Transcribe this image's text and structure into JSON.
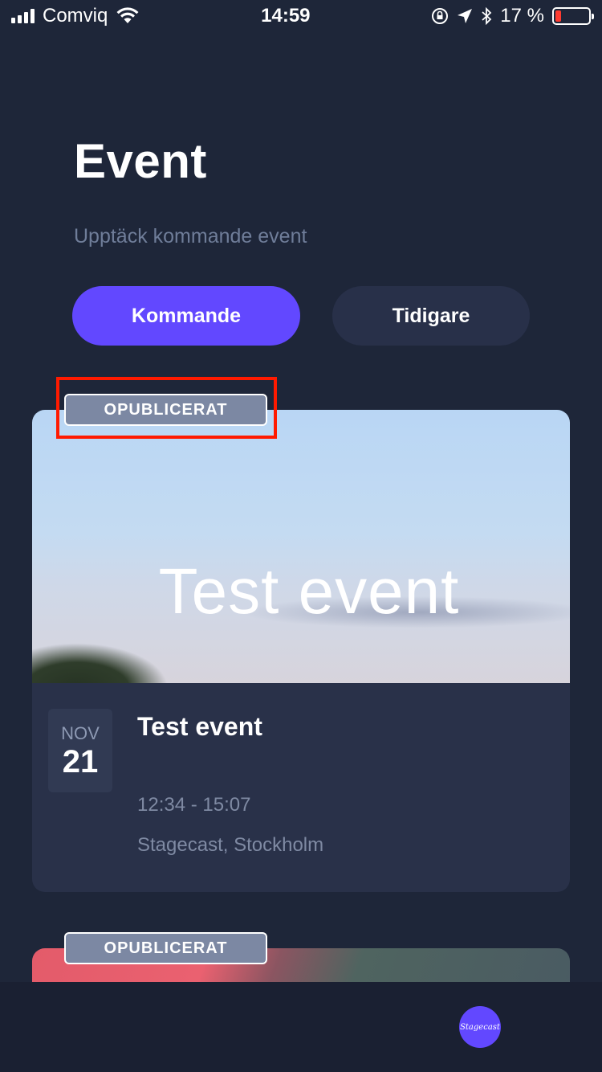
{
  "status_bar": {
    "carrier": "Comviq",
    "time": "14:59",
    "battery_percent": "17 %",
    "battery_level": 0.17,
    "icons": [
      "signal-icon",
      "wifi-icon",
      "rotation-lock-icon",
      "location-icon",
      "bluetooth-icon",
      "battery-icon"
    ]
  },
  "header": {
    "title": "Event",
    "subtitle": "Upptäck kommande event"
  },
  "tabs": [
    {
      "label": "Kommande",
      "active": true
    },
    {
      "label": "Tidigare",
      "active": false
    }
  ],
  "events": [
    {
      "badge": "OPUBLICERAT",
      "image_text": "Test event",
      "month": "NOV",
      "day": "21",
      "title": "Test event",
      "time": "12:34 - 15:07",
      "location": "Stagecast, Stockholm"
    },
    {
      "badge": "OPUBLICERAT"
    }
  ],
  "bottom_bar": {
    "logo_text": "Stagecast"
  },
  "colors": {
    "background": "#1e2639",
    "accent": "#6248ff",
    "card": "#293149",
    "badge": "#7c88a3",
    "highlight": "#ff1a00"
  }
}
